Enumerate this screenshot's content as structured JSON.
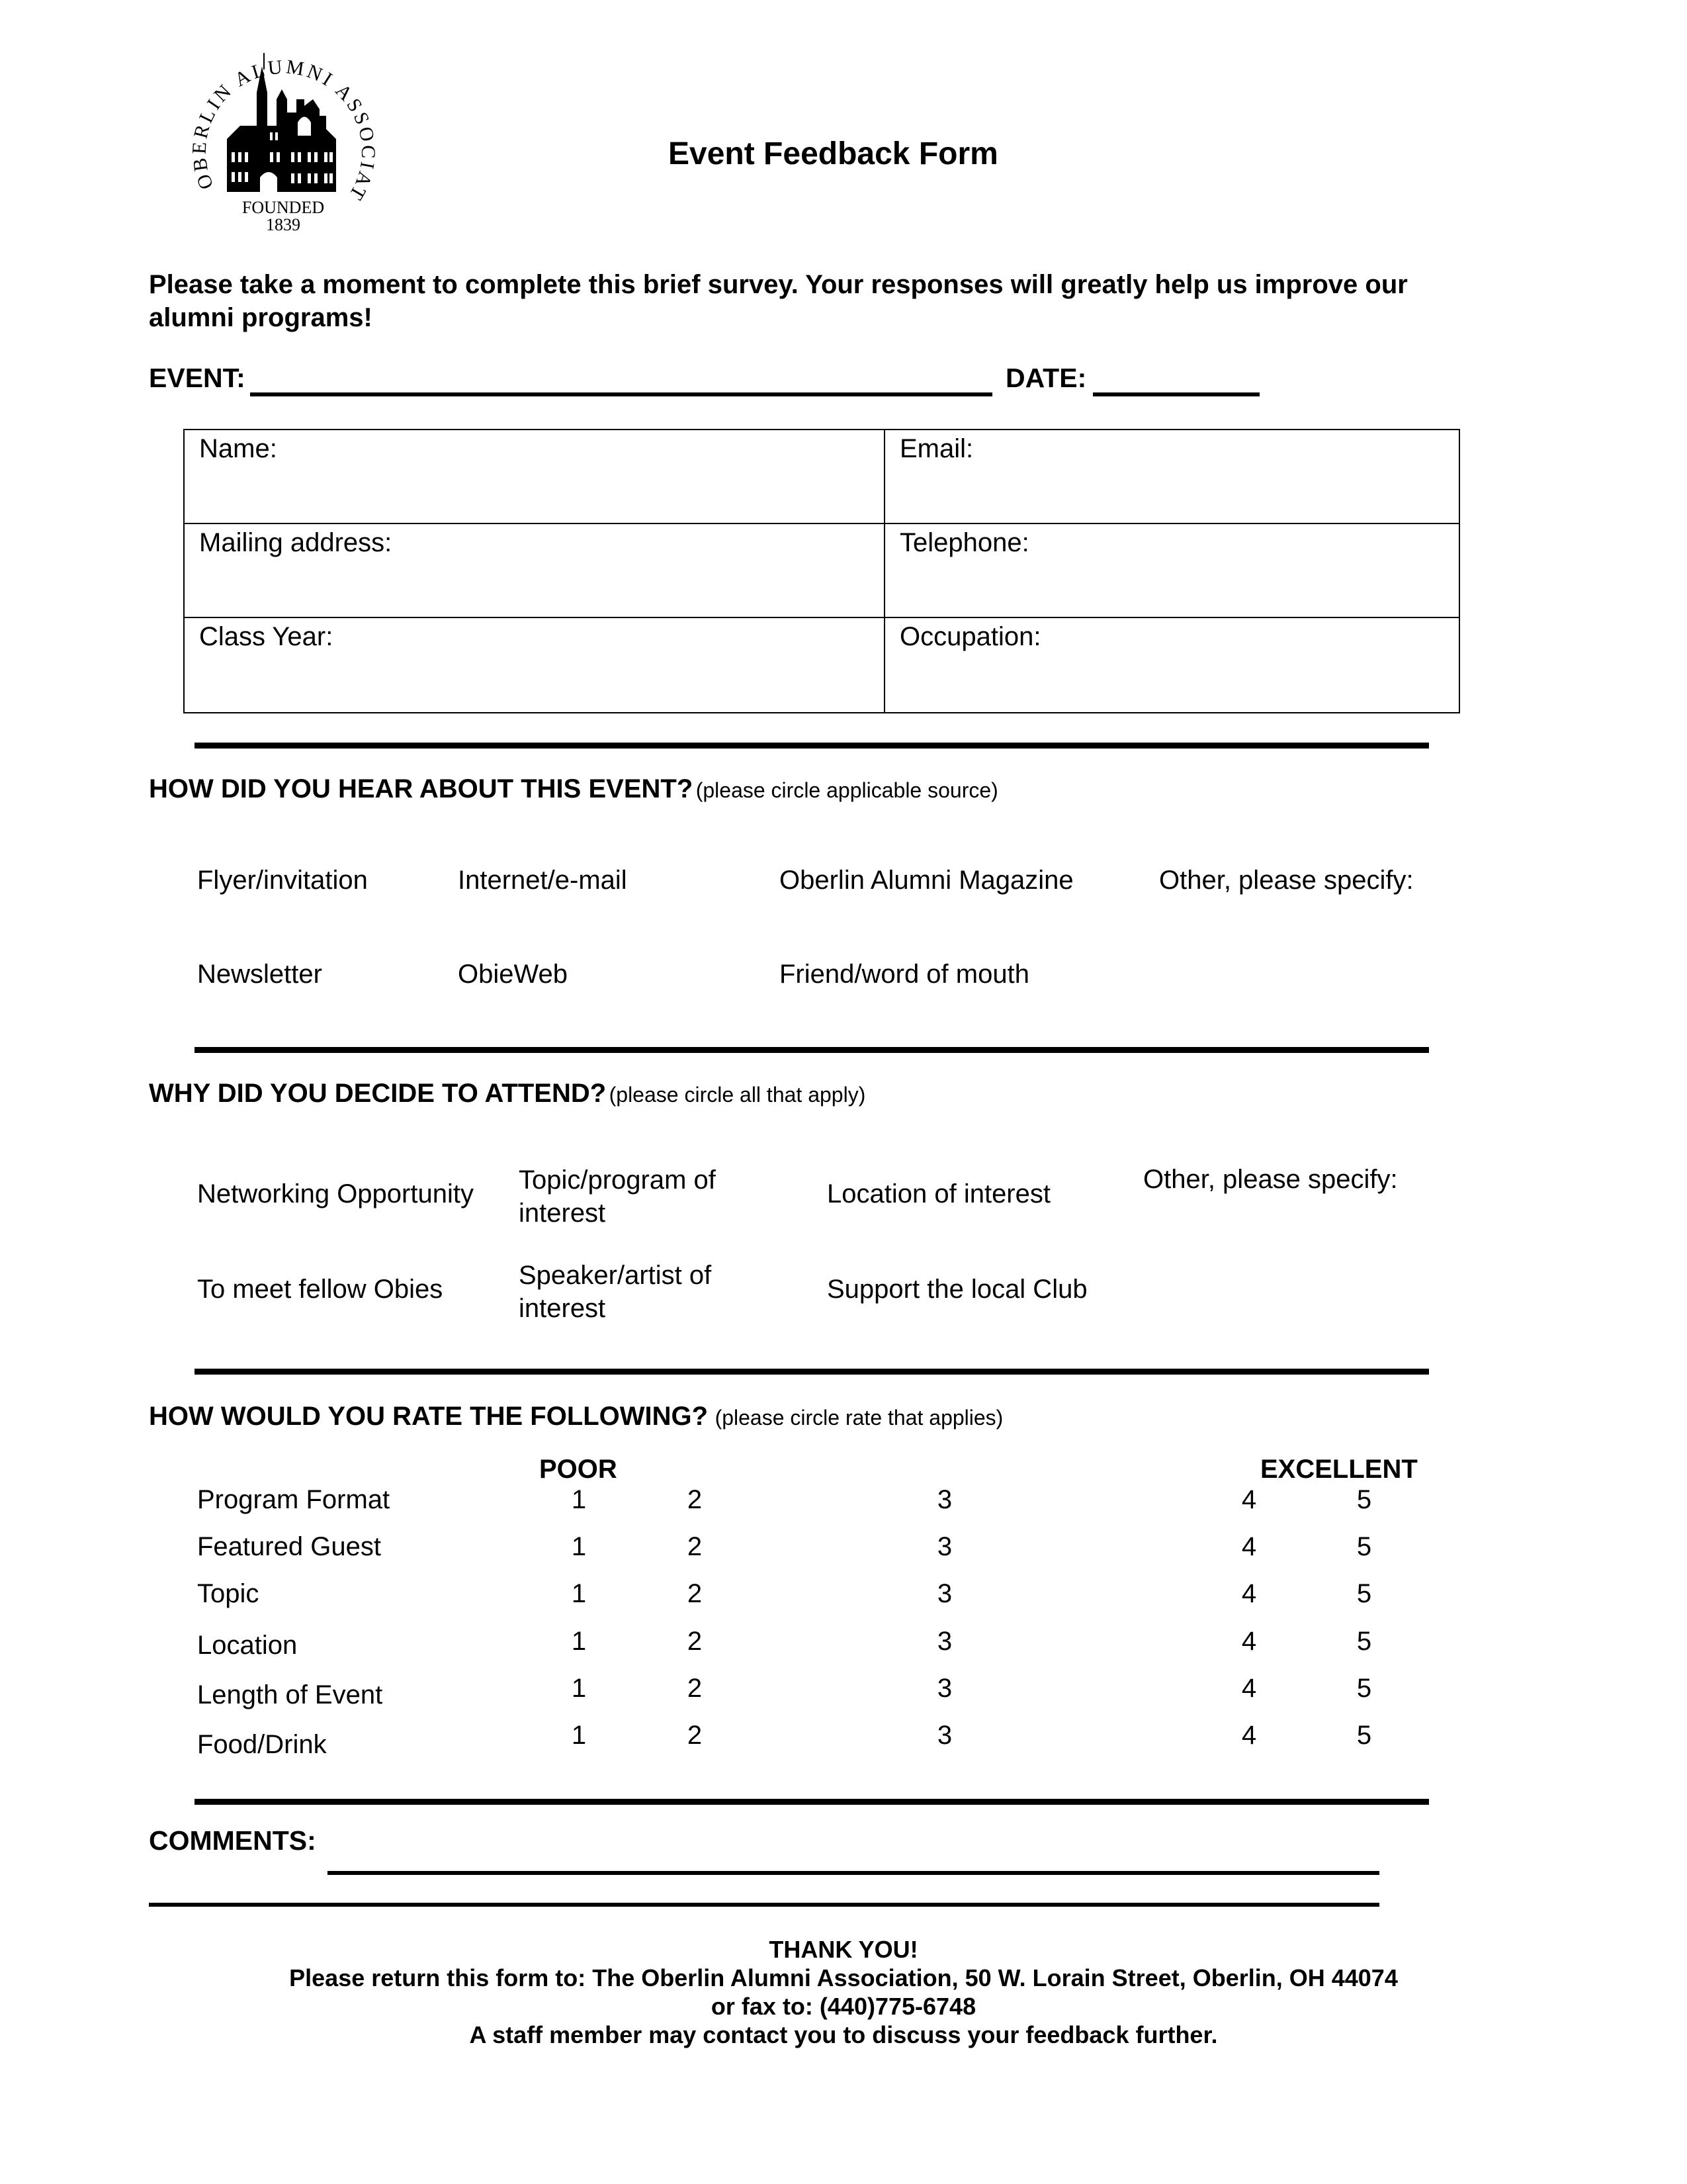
{
  "logo": {
    "arc_text": "OBERLIN ALUMNI ASSOCIATION",
    "founded_label": "FOUNDED",
    "founded_year": "1839"
  },
  "title": "Event Feedback Form",
  "intro": "Please take a moment to complete this brief survey.  Your responses will greatly help us improve our alumni programs!",
  "event_label": "EVENT:",
  "date_label": "DATE:",
  "contact_fields": [
    {
      "label": "Name:",
      "value": ""
    },
    {
      "label": "Email:",
      "value": ""
    },
    {
      "label": "Mailing address:",
      "value": ""
    },
    {
      "label": "Telephone:",
      "value": ""
    },
    {
      "label": "Class Year:",
      "value": ""
    },
    {
      "label": "Occupation:",
      "value": ""
    }
  ],
  "hear_section": {
    "title": "HOW DID YOU HEAR ABOUT THIS EVENT?",
    "note": "(please circle applicable source)",
    "options": [
      "Flyer/invitation",
      "Internet/e-mail",
      "Oberlin Alumni Magazine",
      "Other, please specify:",
      "Newsletter",
      "ObieWeb",
      "Friend/word of mouth"
    ]
  },
  "attend_section": {
    "title": "WHY DID YOU DECIDE TO ATTEND?",
    "note": "(please circle all that apply)",
    "options": [
      "Networking Opportunity",
      "Topic/program of interest",
      "Location of interest",
      "Other, please specify:",
      "To meet fellow Obies",
      "Speaker/artist of interest",
      "Support the local Club"
    ]
  },
  "rate_section": {
    "title": "HOW WOULD YOU RATE THE FOLLOWING?",
    "note": "(please circle rate that applies)",
    "low_label": "POOR",
    "high_label": "EXCELLENT",
    "scale": [
      "1",
      "2",
      "3",
      "4",
      "5"
    ],
    "items": [
      "Program Format",
      "Featured Guest",
      "Topic",
      "Location",
      "Length of Event",
      "Food/Drink"
    ]
  },
  "comments_label": "COMMENTS:",
  "footer": {
    "thanks": "THANK YOU!",
    "return_line": "Please return this form to:  The Oberlin Alumni Association, 50 W. Lorain Street, Oberlin, OH 44074",
    "fax_line": "or fax to: (440)775-6748",
    "contact_line": "A staff member may contact you to discuss your feedback further."
  }
}
